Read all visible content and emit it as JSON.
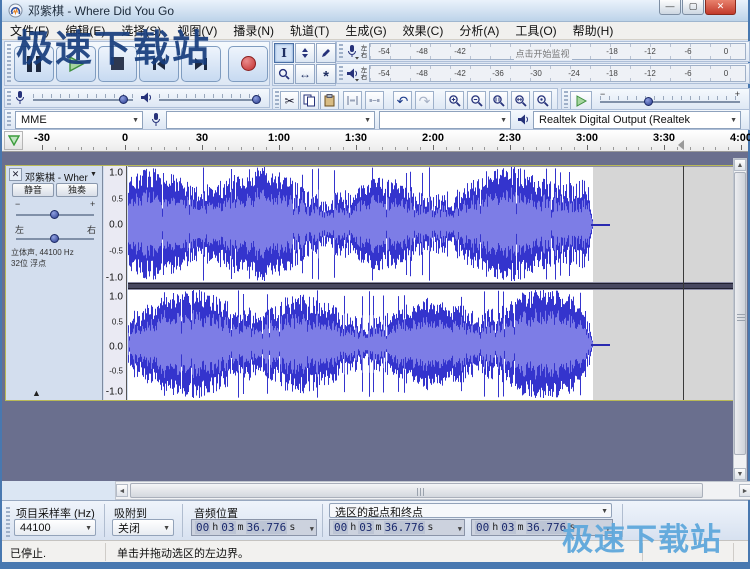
{
  "watermark": {
    "top": "极速下载站",
    "bottom": "极速下载站"
  },
  "window": {
    "title": "邓紫棋 - Where Did You Go"
  },
  "menu": {
    "items": [
      "文件(F)",
      "编辑(E)",
      "选择(S)",
      "视图(V)",
      "播录(N)",
      "轨道(T)",
      "生成(G)",
      "效果(C)",
      "分析(A)",
      "工具(O)",
      "帮助(H)"
    ]
  },
  "meters": {
    "record": {
      "channel_top": "左",
      "channel_bottom": "右",
      "labels": [
        "-54",
        "-48",
        "-42",
        "-18",
        "-12",
        "-6",
        "0"
      ],
      "monitor_text": "点击开始监视"
    },
    "play": {
      "channel_top": "左",
      "channel_bottom": "右",
      "labels": [
        "-54",
        "-48",
        "-42",
        "-36",
        "-30",
        "-24",
        "-18",
        "-12",
        "-6",
        "0"
      ]
    }
  },
  "device": {
    "host": "MME",
    "recording": "",
    "channels": "",
    "playback": "Realtek Digital Output (Realtek"
  },
  "timeline": {
    "labels": [
      "-30",
      "0",
      "30",
      "1:00",
      "1:30",
      "2:00",
      "2:30",
      "3:00",
      "3:30",
      "4:00"
    ]
  },
  "track": {
    "name": "邓紫棋 - Wher",
    "mute_label": "静音",
    "solo_label": "独奏",
    "gain_minus": "−",
    "gain_plus": "+",
    "pan_left": "左",
    "pan_right": "右",
    "info_line1": "立体声, 44100 Hz",
    "info_line2": "32位 浮点",
    "vruler": [
      "1.0",
      "0.5",
      "0.0",
      "-0.5",
      "-1.0"
    ]
  },
  "selection_bar": {
    "rate_label": "项目采样率 (Hz)",
    "rate_value": "44100",
    "snap_label": "吸附到",
    "snap_value": "关闭",
    "audio_pos_label": "音频位置",
    "selection_label": "选区的起点和终点",
    "time": {
      "h": "00",
      "hu": "h",
      "m": "03",
      "mu": "m",
      "s": "36.776",
      "su": "s"
    }
  },
  "status_bar": {
    "state": "已停止.",
    "hint": "单击并拖动选区的左边界。"
  },
  "colors": {
    "wave_peak": "#3434cd",
    "wave_rms": "#7d7de6",
    "accent": "#4878b0"
  }
}
